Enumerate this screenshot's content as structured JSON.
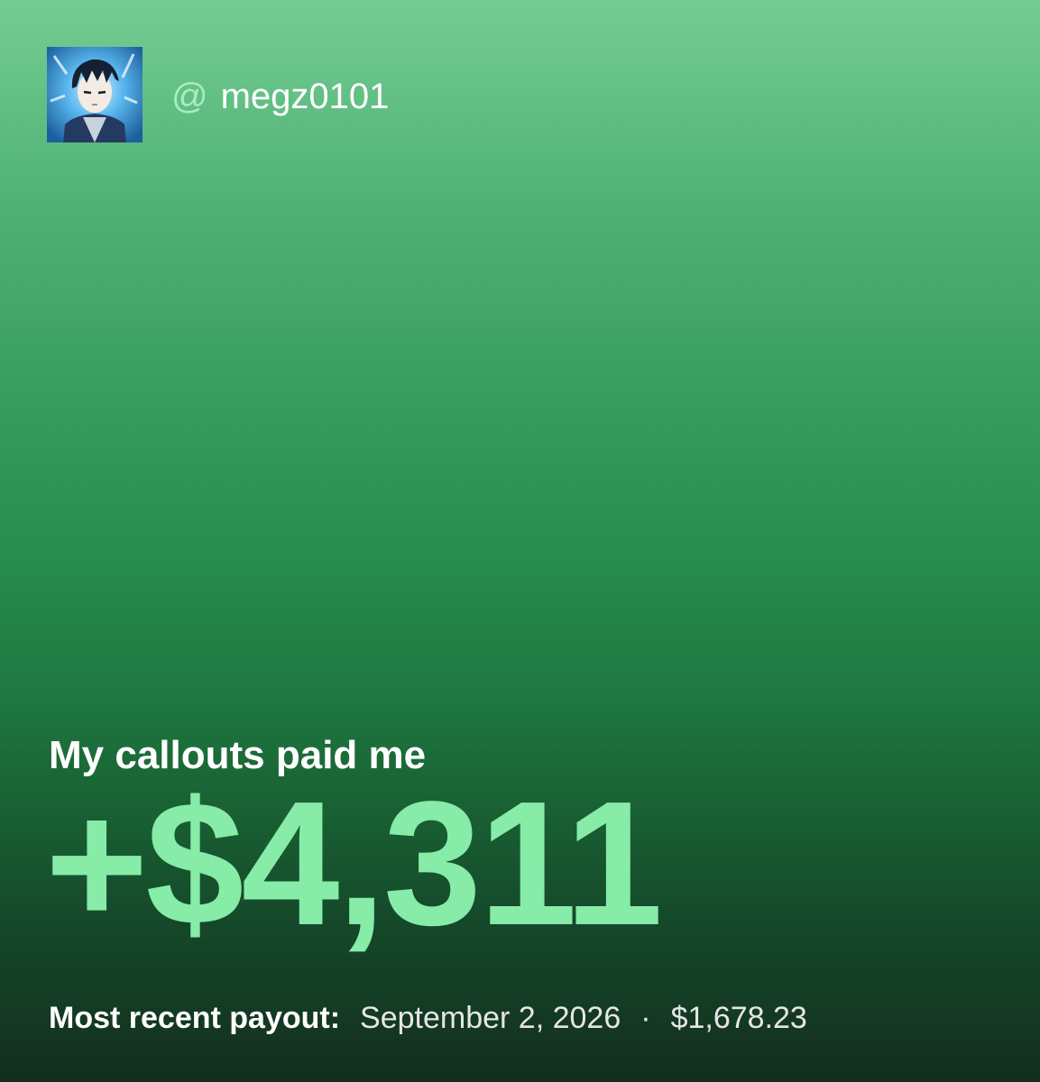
{
  "profile": {
    "avatar_icon": "anime-character-avatar",
    "at_symbol": "@",
    "username": "megz0101"
  },
  "headline": "My callouts paid me",
  "amount": "+$4,311",
  "payout": {
    "label": "Most recent payout:",
    "date": "September 2, 2026",
    "separator": "·",
    "value": "$1,678.23"
  },
  "colors": {
    "amount": "#86eca8",
    "at_symbol": "#a9ecbf",
    "gradient_top": "#74cd93",
    "gradient_bottom": "#132e1e"
  }
}
